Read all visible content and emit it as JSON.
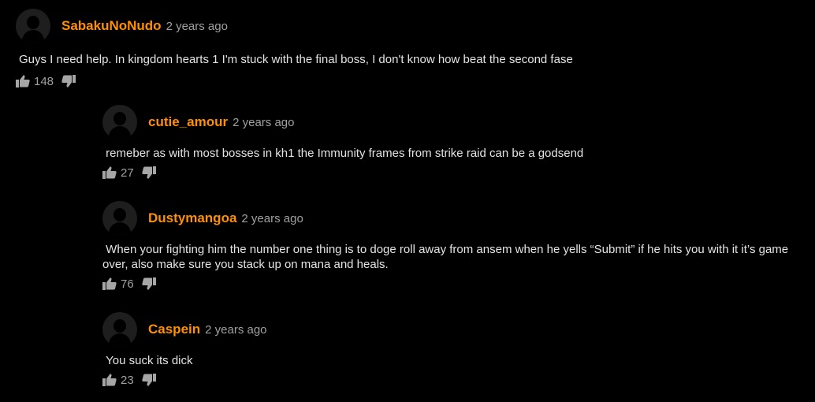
{
  "comments": [
    {
      "username": "SabakuNoNudo",
      "timestamp": "2 years ago",
      "text": "Guys I need help. In kingdom hearts 1 I'm stuck with the final boss, I don't know how beat the second fase",
      "likes": "148",
      "icons": {
        "like": "thumbs-up-icon",
        "dislike": "thumbs-down-icon",
        "avatar": "user-silhouette-icon"
      }
    },
    {
      "username": "cutie_amour",
      "timestamp": "2 years ago",
      "text": " remeber as with most bosses in kh1 the Immunity frames from strike raid can be a godsend",
      "likes": "27",
      "icons": {
        "like": "thumbs-up-icon",
        "dislike": "thumbs-down-icon",
        "avatar": "user-silhouette-icon"
      }
    },
    {
      "username": "Dustymangoa",
      "timestamp": "2 years ago",
      "text": " When your fighting him the number one thing is to doge roll away from ansem when he yells “Submit” if he hits you with it it’s game over, also make sure you stack up on mana and heals.",
      "likes": "76",
      "icons": {
        "like": "thumbs-up-icon",
        "dislike": "thumbs-down-icon",
        "avatar": "user-silhouette-icon"
      }
    },
    {
      "username": "Caspein",
      "timestamp": "2 years ago",
      "text": " You suck its dick",
      "likes": "23",
      "icons": {
        "like": "thumbs-up-icon",
        "dislike": "thumbs-down-icon",
        "avatar": "user-silhouette-icon"
      }
    }
  ],
  "colors": {
    "background": "#000000",
    "username": "#ff9000",
    "meta": "#a0a0a0",
    "text": "#e4e4e4"
  }
}
